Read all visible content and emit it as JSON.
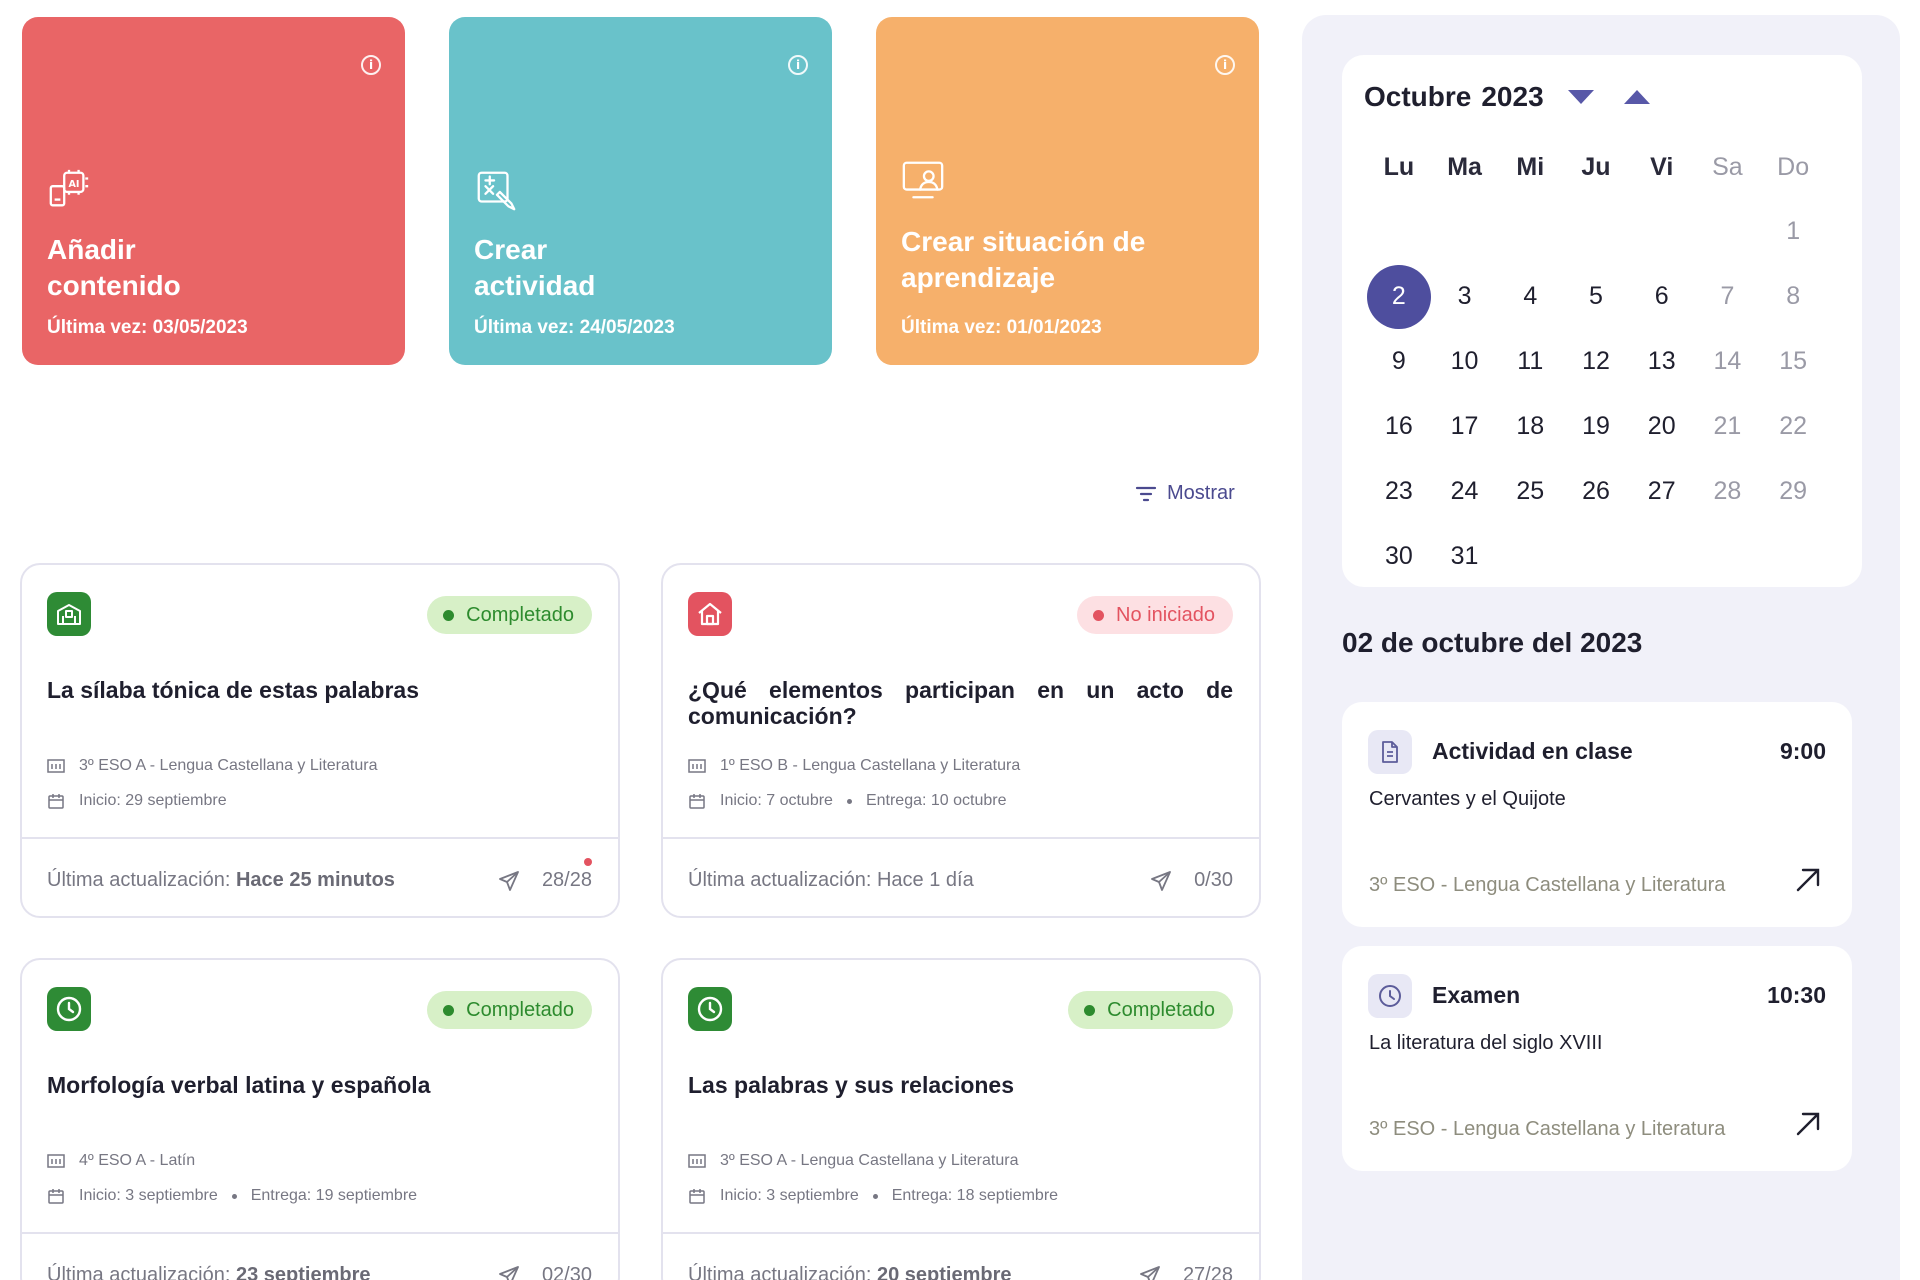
{
  "tiles": [
    {
      "title": "Añadir contenido",
      "subtitle": "Última vez: 03/05/2023",
      "color": "#e96566",
      "icon": "ai-content-icon"
    },
    {
      "title": "Crear actividad",
      "subtitle": "Última vez: 24/05/2023",
      "color": "#69c2ca",
      "icon": "create-activity-icon"
    },
    {
      "title": "Crear situación de aprendizaje",
      "subtitle": "Última vez: 01/01/2023",
      "color": "#f6b06b",
      "icon": "learning-situation-icon"
    }
  ],
  "filter": {
    "label": "Mostrar"
  },
  "cards": [
    {
      "icon": "school-icon",
      "icon_color": "#2e8b35",
      "status": "Completado",
      "title": "La sílaba tónica de estas palabras",
      "course": "3º ESO A - Lengua Castellana y Literatura",
      "start": "Inicio: 29 septiembre",
      "due": "",
      "updated_prefix": "Última actualización:",
      "updated_value": "Hace 25 minutos",
      "count": "28/28"
    },
    {
      "icon": "home-icon",
      "icon_color": "#e35360",
      "status": "No iniciado",
      "title": "¿Qué elementos participan en un acto de comunicación?",
      "course": "1º ESO B - Lengua Castellana y Literatura",
      "start": "Inicio: 7 octubre",
      "due": "Entrega: 10 octubre",
      "updated_prefix": "Última actualización: Hace 1 día",
      "updated_value": "",
      "count": "0/30"
    },
    {
      "icon": "clock-icon",
      "icon_color": "#2e8b35",
      "status": "Completado",
      "title": "Morfología verbal latina y española",
      "course": "4º ESO A - Latín",
      "start": "Inicio: 3 septiembre",
      "due": "Entrega: 19 septiembre",
      "updated_prefix": "Última actualización:",
      "updated_value": "23 septiembre",
      "count": "02/30"
    },
    {
      "icon": "clock-icon",
      "icon_color": "#2e8b35",
      "status": "Completado",
      "title": "Las palabras y sus relaciones",
      "course": "3º ESO A - Lengua Castellana y Literatura",
      "start": "Inicio: 3 septiembre",
      "due": "Entrega: 18 septiembre",
      "updated_prefix": "Última actualización:",
      "updated_value": "20 septiembre",
      "count": "27/28"
    }
  ],
  "calendar": {
    "month": "Octubre",
    "year": "2023",
    "weekdays": [
      "Lu",
      "Ma",
      "Mi",
      "Ju",
      "Vi",
      "Sa",
      "Do"
    ],
    "weeks": [
      [
        "",
        "",
        "",
        "",
        "",
        "",
        "1"
      ],
      [
        "2",
        "3",
        "4",
        "5",
        "6",
        "7",
        "8"
      ],
      [
        "9",
        "10",
        "11",
        "12",
        "13",
        "14",
        "15"
      ],
      [
        "16",
        "17",
        "18",
        "19",
        "20",
        "21",
        "22"
      ],
      [
        "23",
        "24",
        "25",
        "26",
        "27",
        "28",
        "29"
      ],
      [
        "30",
        "31",
        "",
        "",
        "",
        "",
        ""
      ]
    ],
    "selected": "2",
    "accent": "#4e4e9e"
  },
  "agenda": {
    "date_title": "02 de octubre del 2023",
    "events": [
      {
        "icon": "document-icon",
        "title": "Actividad en clase",
        "time": "9:00",
        "description": "Cervantes y el Quijote",
        "course": "3º ESO - Lengua Castellana y Literatura"
      },
      {
        "icon": "clock-icon",
        "title": "Examen",
        "time": "10:30",
        "description": "La literatura del siglo XVIII",
        "course": "3º ESO - Lengua Castellana y Literatura"
      }
    ]
  }
}
